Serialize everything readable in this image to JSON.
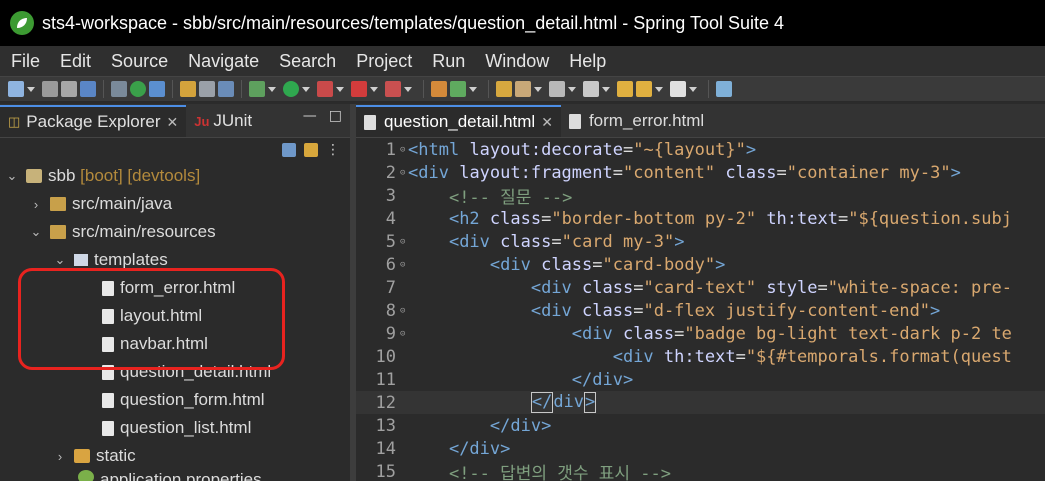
{
  "window": {
    "title": "sts4-workspace - sbb/src/main/resources/templates/question_detail.html - Spring Tool Suite 4"
  },
  "menubar": [
    "File",
    "Edit",
    "Source",
    "Navigate",
    "Search",
    "Project",
    "Run",
    "Window",
    "Help"
  ],
  "left_panel": {
    "tabs": [
      {
        "label": "Package Explorer",
        "active": true
      },
      {
        "label": "JUnit",
        "active": false
      }
    ],
    "tree": {
      "project": {
        "name": "sbb",
        "tags": "[boot] [devtools]"
      },
      "src_main_java": "src/main/java",
      "src_main_resources": "src/main/resources",
      "templates": "templates",
      "files": [
        "form_error.html",
        "layout.html",
        "navbar.html",
        "question_detail.html",
        "question_form.html",
        "question_list.html"
      ],
      "static": "static",
      "partial": "application.properties"
    }
  },
  "editor": {
    "tabs": [
      {
        "label": "question_detail.html",
        "active": true
      },
      {
        "label": "form_error.html",
        "active": false
      }
    ],
    "lines": [
      {
        "n": "1",
        "fold": true,
        "code": "<html layout:decorate=\"~{layout}\">"
      },
      {
        "n": "2",
        "fold": true,
        "code": "<div layout:fragment=\"content\" class=\"container my-3\">"
      },
      {
        "n": "3",
        "fold": false,
        "code": "    <!-- 질문 -->"
      },
      {
        "n": "4",
        "fold": false,
        "code": "    <h2 class=\"border-bottom py-2\" th:text=\"${question.subj"
      },
      {
        "n": "5",
        "fold": true,
        "code": "    <div class=\"card my-3\">"
      },
      {
        "n": "6",
        "fold": true,
        "code": "        <div class=\"card-body\">"
      },
      {
        "n": "7",
        "fold": false,
        "code": "            <div class=\"card-text\" style=\"white-space: pre-"
      },
      {
        "n": "8",
        "fold": true,
        "code": "            <div class=\"d-flex justify-content-end\">"
      },
      {
        "n": "9",
        "fold": true,
        "code": "                <div class=\"badge bg-light text-dark p-2 te"
      },
      {
        "n": "10",
        "fold": false,
        "code": "                    <div th:text=\"${#temporals.format(quest"
      },
      {
        "n": "11",
        "fold": false,
        "code": "                </div>"
      },
      {
        "n": "12",
        "fold": false,
        "code": "            </div>"
      },
      {
        "n": "13",
        "fold": false,
        "code": "        </div>"
      },
      {
        "n": "14",
        "fold": false,
        "code": "    </div>"
      },
      {
        "n": "15",
        "fold": false,
        "code": "    <!-- 답변의 갯수 표시 -->"
      }
    ]
  }
}
